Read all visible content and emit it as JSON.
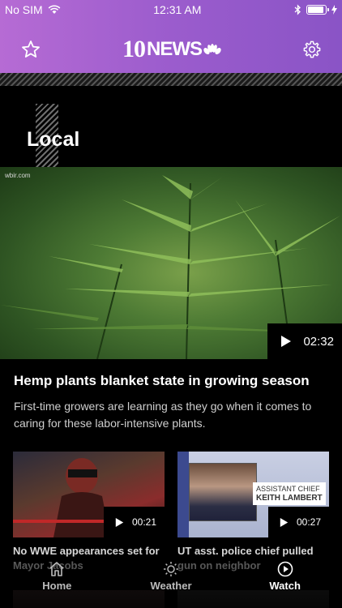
{
  "status_bar": {
    "carrier": "No SIM",
    "time": "12:31 AM"
  },
  "header": {
    "logo_number": "10",
    "logo_text": "NEWS",
    "favorites_icon": "star-icon",
    "settings_icon": "gear-icon",
    "gradient_colors": [
      "#b66bd4",
      "#8a54c6"
    ]
  },
  "section": {
    "title": "Local"
  },
  "hero": {
    "watermark": "wbir.com",
    "duration": "02:32",
    "headline": "Hemp plants blanket state in growing season",
    "summary": "First-time growers are learning as they go when it comes to caring for these labor-intensive plants."
  },
  "cards": [
    {
      "duration": "00:21",
      "title": "No WWE appearances set for Mayor Jacobs"
    },
    {
      "duration": "00:27",
      "lower_third_line1": "ASSISTANT CHIEF",
      "lower_third_line2": "KEITH LAMBERT",
      "title": "UT asst. police chief pulled gun on neighbor"
    }
  ],
  "tabbar": {
    "tabs": [
      {
        "label": "Home",
        "icon": "home-icon",
        "active": false
      },
      {
        "label": "Weather",
        "icon": "sun-icon",
        "active": false
      },
      {
        "label": "Watch",
        "icon": "play-circle-icon",
        "active": true
      }
    ]
  }
}
